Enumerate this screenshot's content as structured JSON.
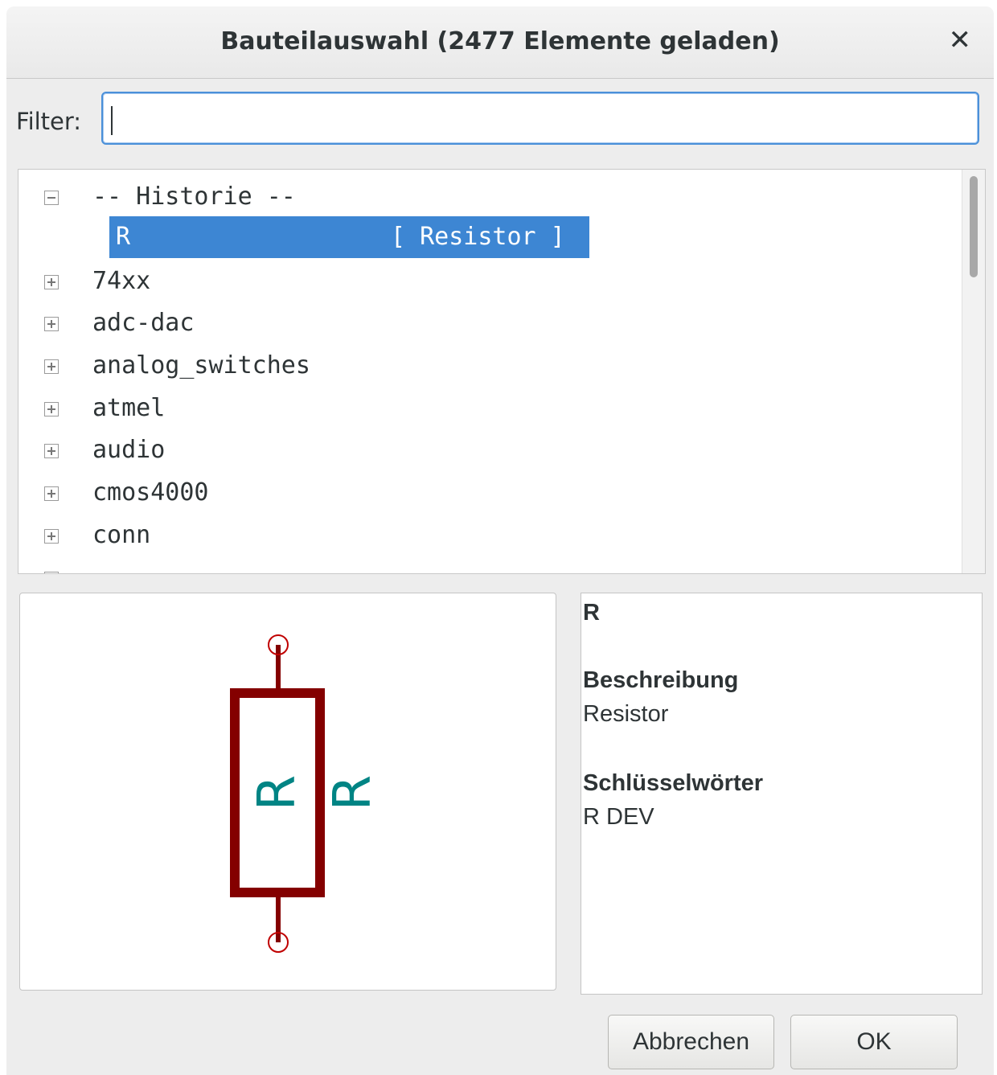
{
  "dialog": {
    "title": "Bauteilauswahl (2477 Elemente geladen)",
    "close_icon": "close-icon"
  },
  "filter": {
    "label": "Filter:",
    "value": "",
    "placeholder": ""
  },
  "tree": {
    "history_label": "-- Historie --",
    "history_item": {
      "name": "R",
      "desc": "[ Resistor ]"
    },
    "libraries": [
      "74xx",
      "adc-dac",
      "analog_switches",
      "atmel",
      "audio",
      "cmos4000",
      "conn"
    ]
  },
  "preview": {
    "symbol": "resistor-symbol",
    "ref_text": "R",
    "value_text": "R",
    "colors": {
      "body": "#840000",
      "text": "#008484",
      "pin": "#c00000"
    }
  },
  "info": {
    "name": "R",
    "desc_heading": "Beschreibung",
    "desc_value": "Resistor",
    "keywords_heading": "Schlüsselwörter",
    "keywords_value": "R DEV"
  },
  "buttons": {
    "cancel": "Abbrechen",
    "ok": "OK"
  }
}
